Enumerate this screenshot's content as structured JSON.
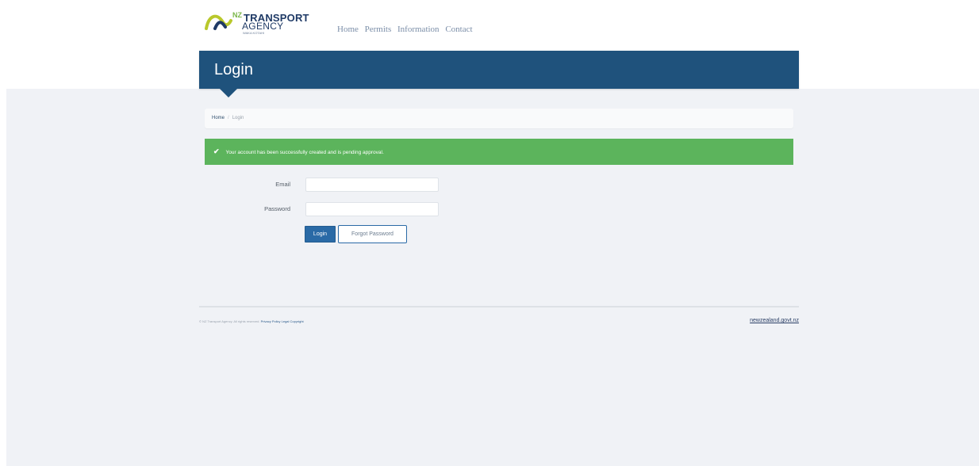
{
  "logo": {
    "prefix": "NZ",
    "line1": "TRANSPORT",
    "line2": "AGENCY",
    "tagline": "WAKA KOTAHI"
  },
  "nav": {
    "items": [
      "Home",
      "Permits",
      "Information",
      "Contact"
    ]
  },
  "page": {
    "title": "Login"
  },
  "breadcrumb": {
    "home": "Home",
    "separator": "/",
    "current": "Login"
  },
  "alert": {
    "icon": "check-icon",
    "message": "Your account has been successfully created and is pending approval."
  },
  "form": {
    "email_label": "Email",
    "email_value": "",
    "password_label": "Password",
    "password_value": "",
    "login_button": "Login",
    "forgot_button": "Forgot Password"
  },
  "footer": {
    "copyright": "© NZ Transport Agency. All rights reserved.",
    "links": [
      "Privacy Policy",
      "Legal",
      "Copyright"
    ],
    "gov_link": "newzealand.govt.nz"
  },
  "colors": {
    "brand_blue": "#1f527c",
    "success_green": "#5cb45c",
    "page_background": "#f0f2f6",
    "button_blue": "#2a6aa6"
  }
}
